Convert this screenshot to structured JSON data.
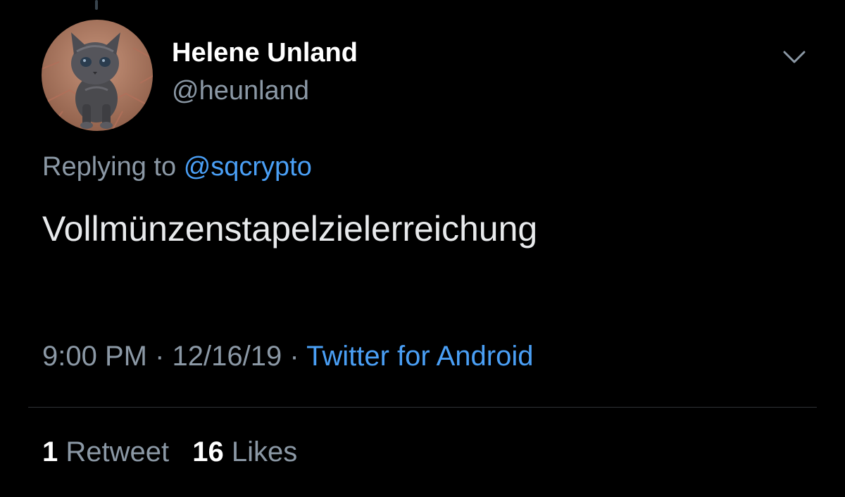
{
  "author": {
    "display_name": "Helene Unland",
    "handle": "@heunland",
    "avatar": "kitten-photo"
  },
  "reply_context": {
    "prefix": "Replying to",
    "mention": "@sqcrypto"
  },
  "tweet": {
    "text": "Vollmünzenstapelzielerreichung"
  },
  "meta": {
    "time": "9:00 PM",
    "separator": "·",
    "date": "12/16/19",
    "source": "Twitter for Android"
  },
  "stats": {
    "retweet_count": "1",
    "retweet_label": "Retweet",
    "like_count": "16",
    "like_label": "Likes"
  },
  "icons": {
    "menu": "chevron-down-icon"
  },
  "colors": {
    "background": "#000000",
    "accent": "#4a9ff5",
    "secondary_text": "#8b98a5",
    "primary_text": "#ffffff"
  }
}
